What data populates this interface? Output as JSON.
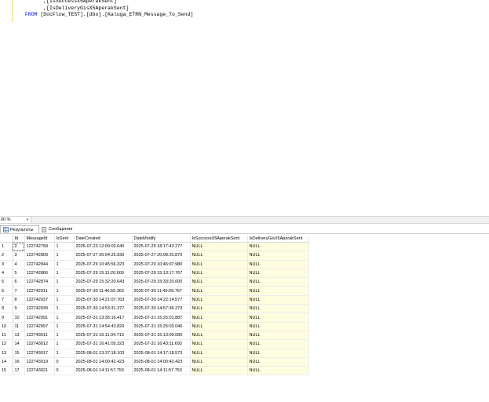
{
  "editor": {
    "lines": [
      {
        "indent": "        ",
        "text": ",[IsSuccessX5AperakSent]",
        "kw": ""
      },
      {
        "indent": "        ",
        "text": ",[IsDeliveryGisX5AperakSent]",
        "kw": ""
      },
      {
        "indent": "  ",
        "text": " [DocFlow_TEST].[dbo].[Kaluga_ETRN_Message_To_Send]",
        "kw": "FROM"
      }
    ]
  },
  "zoom": {
    "value": "00 %"
  },
  "tabs": [
    {
      "label": "Результаты",
      "icon": "grid-icon"
    },
    {
      "label": "Сообщения",
      "icon": "messages-icon"
    }
  ],
  "grid": {
    "columns": [
      "Id",
      "MessageId",
      "IsSent",
      "DateCreated",
      "DateModify",
      "IsSuccessX5AperakSent",
      "IsDeliveryGisX5AperakSent"
    ],
    "rows": [
      [
        "1",
        "2",
        "122742758",
        "1",
        "2025-07-23 12:09:02.640",
        "2025-07-25 18:17:43.277",
        "NULL",
        "NULL"
      ],
      [
        "2",
        "3",
        "122742809",
        "1",
        "2025-07-27 20:04:25.930",
        "2025-07-27 20:08:20.870",
        "NULL",
        "NULL"
      ],
      [
        "3",
        "4",
        "122742844",
        "1",
        "2025-07-29 10:45:56.323",
        "2025-07-29 10:46:07.980",
        "NULL",
        "NULL"
      ],
      [
        "4",
        "5",
        "122742866",
        "1",
        "2025-07-29 15:11:20.600",
        "2025-07-29 15:13:17.767",
        "NULL",
        "NULL"
      ],
      [
        "5",
        "6",
        "122742874",
        "1",
        "2025-07-29 15:32:20.643",
        "2025-07-29 15:33:20.000",
        "NULL",
        "NULL"
      ],
      [
        "6",
        "7",
        "122742911",
        "1",
        "2025-07-30 11:46:55.363",
        "2025-07-30 11:49:09.767",
        "NULL",
        "NULL"
      ],
      [
        "7",
        "8",
        "122742937",
        "1",
        "2025-07-30 14:21:07.763",
        "2025-07-30 14:22:14.577",
        "NULL",
        "NULL"
      ],
      [
        "8",
        "9",
        "122742939",
        "1",
        "2025-07-30 14:53:31.377",
        "2025-07-30 14:57:36.273",
        "NULL",
        "NULL"
      ],
      [
        "9",
        "10",
        "122742991",
        "1",
        "2025-07-31 13:35:16.417",
        "2025-07-31 15:26:01.887",
        "NULL",
        "NULL"
      ],
      [
        "10",
        "11",
        "122742997",
        "1",
        "2025-07-31 14:54:43.820",
        "2025-07-31 15:26:03.040",
        "NULL",
        "NULL"
      ],
      [
        "11",
        "13",
        "122743011",
        "1",
        "2025-07-31 16:11:34.713",
        "2025-07-31 16:13:09.080",
        "NULL",
        "NULL"
      ],
      [
        "12",
        "14",
        "122743012",
        "1",
        "2025-07-31 16:41:05.323",
        "2025-07-31 16:43:11.693",
        "NULL",
        "NULL"
      ],
      [
        "13",
        "15",
        "122743017",
        "1",
        "2025-08-01 13:37:18.103",
        "2025-08-01 14:17:18.573",
        "NULL",
        "NULL"
      ],
      [
        "14",
        "16",
        "122743019",
        "0",
        "2025-08-01 14:00:42.423",
        "2025-08-01 14:00:42.423",
        "NULL",
        "NULL"
      ],
      [
        "15",
        "17",
        "122743021",
        "0",
        "2025-08-01 14:11:57.753",
        "2025-08-01 14:11:57.753",
        "NULL",
        "NULL"
      ]
    ]
  },
  "colors": {
    "null_cell": "#fffde0",
    "keyword": "#0000ff"
  }
}
